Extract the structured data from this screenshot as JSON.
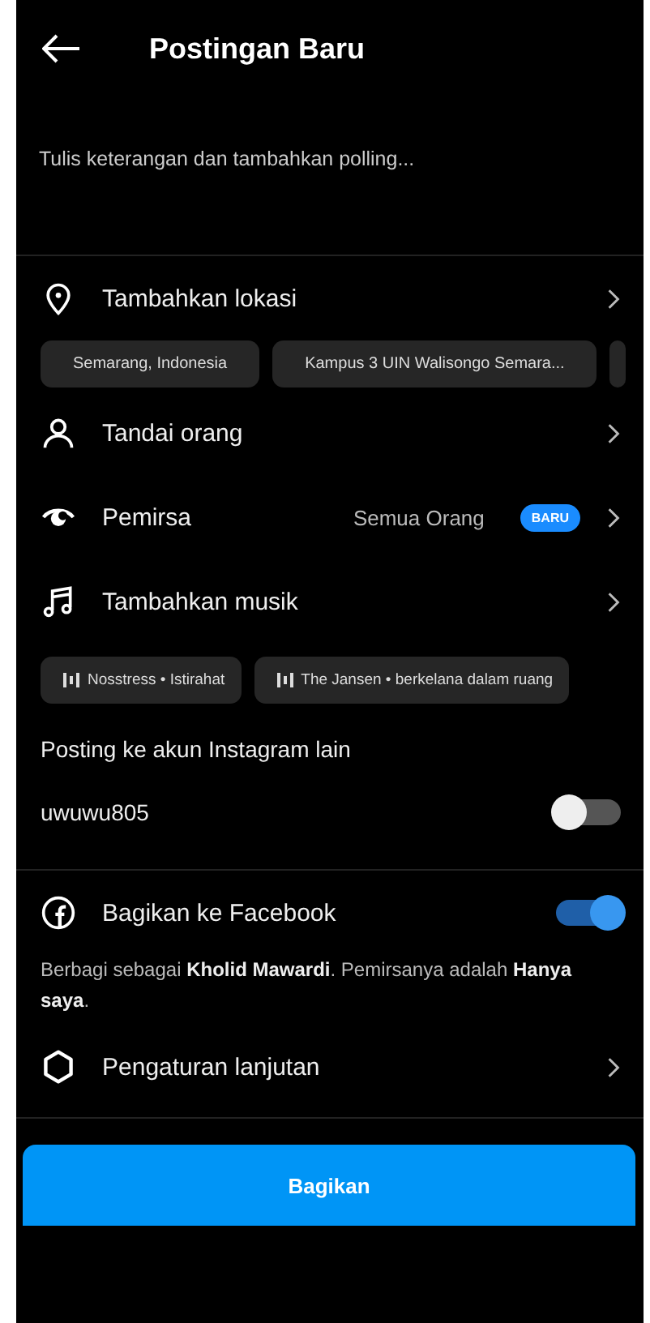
{
  "header": {
    "title": "Postingan Baru"
  },
  "caption": {
    "placeholder": "Tulis keterangan dan tambahkan polling..."
  },
  "location": {
    "label": "Tambahkan lokasi",
    "chips": [
      "Semarang, Indonesia",
      "Kampus 3 UIN Walisongo Semara..."
    ]
  },
  "tag_people": {
    "label": "Tandai orang"
  },
  "audience": {
    "label": "Pemirsa",
    "value": "Semua Orang",
    "badge": "BARU"
  },
  "music": {
    "label": "Tambahkan musik",
    "chips": [
      "Nosstress • Istirahat",
      "The Jansen • berkelana dalam ruang"
    ]
  },
  "other_accounts": {
    "heading": "Posting ke akun Instagram lain",
    "accounts": [
      {
        "name": "uwuwu805",
        "on": false
      }
    ]
  },
  "facebook": {
    "label": "Bagikan ke Facebook",
    "on": true,
    "note": "Berbagi sebagai **Kholid Mawardi**. Pemirsanya adalah **Hanya saya**."
  },
  "advanced": {
    "label": "Pengaturan lanjutan"
  },
  "share_button": "Bagikan"
}
